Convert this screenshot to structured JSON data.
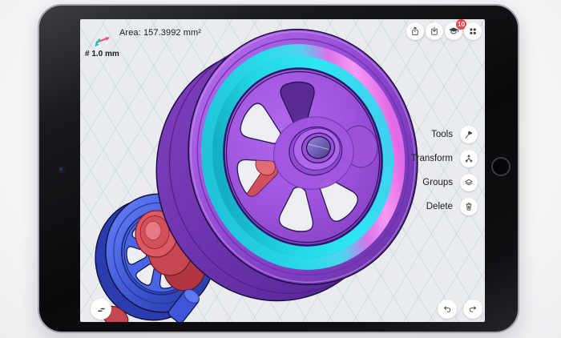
{
  "viewport": {
    "area_label": "Area: 157.3992 mm²",
    "grid_size_label": "# 1.0 mm",
    "axis_indicator_icon": "sketch-axes-icon"
  },
  "top_toolbar": {
    "buttons": [
      {
        "id": "share",
        "icon": "share-icon"
      },
      {
        "id": "import",
        "icon": "import-icon"
      },
      {
        "id": "learn",
        "icon": "graduation-cap-icon",
        "badge": "10"
      },
      {
        "id": "apps",
        "icon": "apps-grid-icon"
      }
    ]
  },
  "right_menu": {
    "items": [
      {
        "label": "Tools",
        "icon": "hammer-icon"
      },
      {
        "label": "Transform",
        "icon": "transform-gizmo-icon"
      },
      {
        "label": "Groups",
        "icon": "layers-icon"
      },
      {
        "label": "Delete",
        "icon": "trash-icon"
      }
    ]
  },
  "bottom_toolbar": {
    "left_buttons": [
      {
        "id": "items-panel",
        "icon": "list-icon"
      }
    ],
    "right_buttons": [
      {
        "id": "undo",
        "icon": "undo-icon"
      },
      {
        "id": "redo",
        "icon": "redo-icon"
      }
    ]
  },
  "colors": {
    "canvas_background": "#e9ebef",
    "model_purple": "#9a50d8",
    "model_magenta": "#ee8ef0",
    "model_cyan": "#26dcec",
    "model_red": "#d6535f",
    "model_blue": "#4a62e0",
    "badge_red": "#fb3f46"
  }
}
